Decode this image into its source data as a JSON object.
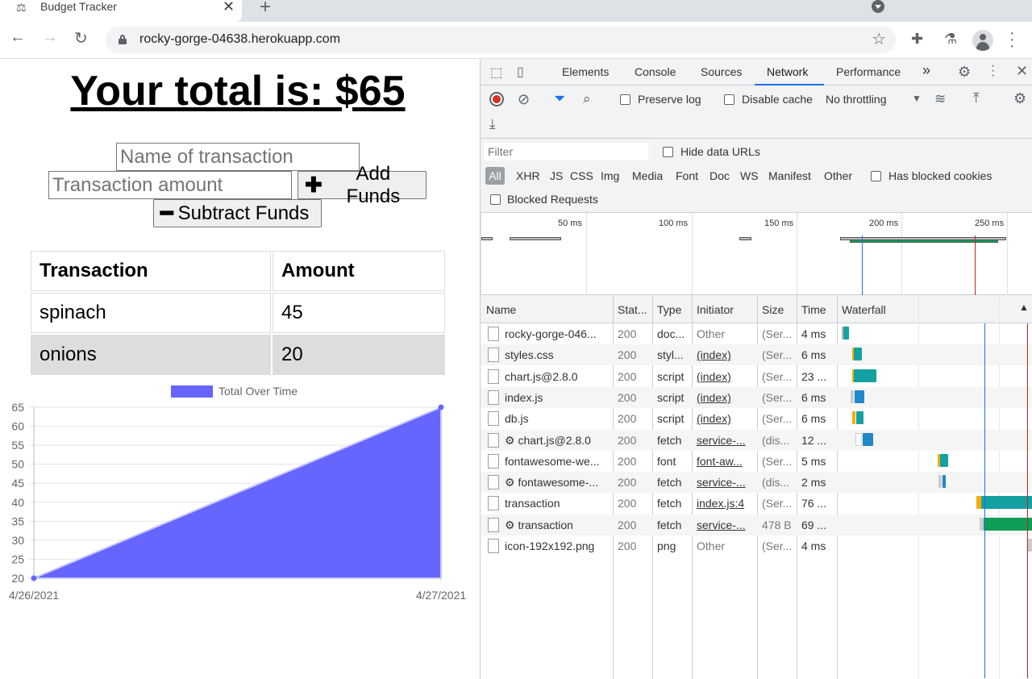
{
  "browser": {
    "tab_title": "Budget Tracker",
    "url": "rocky-gorge-04638.herokuapp.com",
    "new_tab": "+",
    "close": "✕"
  },
  "page": {
    "total_label": "Your total is: $",
    "total_value": "65",
    "name_placeholder": "Name of transaction",
    "amount_placeholder": "Transaction amount",
    "add_button": "Add Funds",
    "subtract_button": "Subtract Funds",
    "table": {
      "headers": [
        "Transaction",
        "Amount"
      ],
      "rows": [
        {
          "name": "spinach",
          "amount": "45"
        },
        {
          "name": "onions",
          "amount": "20"
        }
      ]
    }
  },
  "chart_data": {
    "type": "area",
    "series": [
      {
        "name": "Total Over Time",
        "values": [
          20,
          65
        ]
      }
    ],
    "categories": [
      "4/26/2021",
      "4/27/2021"
    ],
    "ylim": [
      20,
      65
    ],
    "yticks": [
      65,
      60,
      55,
      50,
      45,
      40,
      35,
      30,
      25,
      20
    ],
    "legend": "top",
    "fill_color": "#6666ff",
    "grid": true
  },
  "devtools": {
    "tabs": [
      "Elements",
      "Console",
      "Sources",
      "Network",
      "Performance"
    ],
    "active_tab": "Network",
    "more": "»",
    "preserve_log": "Preserve log",
    "disable_cache": "Disable cache",
    "throttling": "No throttling",
    "filter_placeholder": "Filter",
    "hide_data_urls": "Hide data URLs",
    "type_filters": [
      "All",
      "XHR",
      "JS",
      "CSS",
      "Img",
      "Media",
      "Font",
      "Doc",
      "WS",
      "Manifest",
      "Other"
    ],
    "has_blocked_cookies": "Has blocked cookies",
    "blocked_requests": "Blocked Requests",
    "timeline_labels": [
      "50 ms",
      "100 ms",
      "150 ms",
      "200 ms",
      "250 ms"
    ],
    "columns": [
      "Name",
      "Stat...",
      "Type",
      "Initiator",
      "Size",
      "Time",
      "Waterfall"
    ],
    "requests": [
      {
        "name": "rocky-gorge-046...",
        "status": "200",
        "type": "doc...",
        "initiator": "Other",
        "size": "(Ser...",
        "time": "4 ms",
        "sw": false
      },
      {
        "name": "styles.css",
        "status": "200",
        "type": "styl...",
        "initiator": "(index)",
        "size": "(Ser...",
        "time": "6 ms",
        "sw": false
      },
      {
        "name": "chart.js@2.8.0",
        "status": "200",
        "type": "script",
        "initiator": "(index)",
        "size": "(Ser...",
        "time": "23 ...",
        "sw": false
      },
      {
        "name": "index.js",
        "status": "200",
        "type": "script",
        "initiator": "(index)",
        "size": "(Ser...",
        "time": "6 ms",
        "sw": false
      },
      {
        "name": "db.js",
        "status": "200",
        "type": "script",
        "initiator": "(index)",
        "size": "(Ser...",
        "time": "6 ms",
        "sw": false
      },
      {
        "name": "⚙ chart.js@2.8.0",
        "status": "200",
        "type": "fetch",
        "initiator": "service-...",
        "size": "(dis...",
        "time": "12 ...",
        "sw": true
      },
      {
        "name": "fontawesome-we...",
        "status": "200",
        "type": "font",
        "initiator": "font-aw...",
        "size": "(Ser...",
        "time": "5 ms",
        "sw": false
      },
      {
        "name": "⚙ fontawesome-...",
        "status": "200",
        "type": "fetch",
        "initiator": "service-...",
        "size": "(dis...",
        "time": "2 ms",
        "sw": true
      },
      {
        "name": "transaction",
        "status": "200",
        "type": "fetch",
        "initiator": "index.js:4",
        "size": "(Ser...",
        "time": "76 ...",
        "sw": false
      },
      {
        "name": "⚙ transaction",
        "status": "200",
        "type": "fetch",
        "initiator": "service-...",
        "size": "478 B",
        "time": "69 ...",
        "sw": true
      },
      {
        "name": "icon-192x192.png",
        "status": "200",
        "type": "png",
        "initiator": "Other",
        "size": "(Ser...",
        "time": "4 ms",
        "sw": false
      }
    ]
  }
}
